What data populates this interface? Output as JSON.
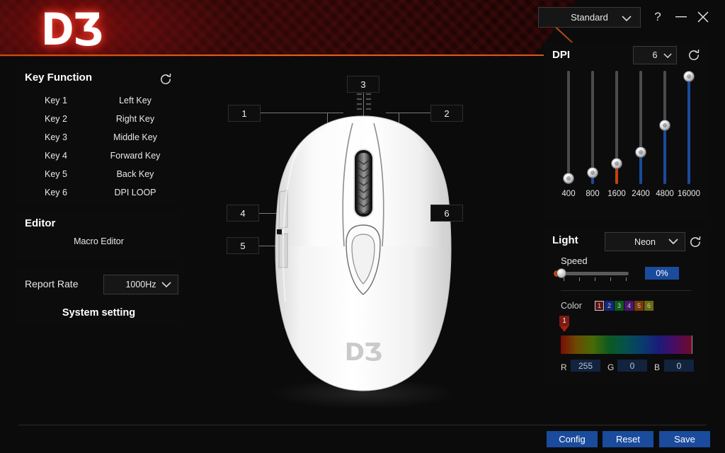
{
  "header": {
    "logo_text": "DƷ",
    "profile": {
      "value": "Standard",
      "caret": "chevron-down-icon"
    },
    "help": "?",
    "minimize": "—",
    "close": "✕"
  },
  "sidebar": {
    "key_function": {
      "title": "Key Function",
      "refresh": "refresh-icon",
      "rows": [
        {
          "key": "Key 1",
          "value": "Left Key"
        },
        {
          "key": "Key 2",
          "value": "Right Key"
        },
        {
          "key": "Key 3",
          "value": "Middle Key"
        },
        {
          "key": "Key 4",
          "value": "Forward Key"
        },
        {
          "key": "Key 5",
          "value": "Back Key"
        },
        {
          "key": "Key 6",
          "value": "DPI LOOP"
        }
      ]
    },
    "editor": {
      "title": "Editor",
      "item": "Macro Editor"
    },
    "report_rate": {
      "label": "Report Rate",
      "value": "1000Hz",
      "caret": "chevron-down-icon"
    },
    "system_setting": "System setting"
  },
  "diagram": {
    "callouts": [
      {
        "id": "1",
        "label": "1"
      },
      {
        "id": "2",
        "label": "2"
      },
      {
        "id": "3",
        "label": "3"
      },
      {
        "id": "4",
        "label": "4"
      },
      {
        "id": "5",
        "label": "5"
      },
      {
        "id": "6",
        "label": "6"
      }
    ],
    "mouse_logo": "DƷ"
  },
  "dpi": {
    "title": "DPI",
    "stage_value": "6",
    "caret": "chevron-down-icon",
    "refresh": "refresh-icon",
    "stages": [
      {
        "label": "400",
        "value": 400,
        "percent": 5,
        "color": "#1a4b9c"
      },
      {
        "label": "800",
        "value": 800,
        "percent": 10,
        "color": "#1a4b9c"
      },
      {
        "label": "1600",
        "value": 1600,
        "percent": 18,
        "color": "#c2440d"
      },
      {
        "label": "2400",
        "value": 2400,
        "percent": 28,
        "color": "#1a4b9c"
      },
      {
        "label": "4800",
        "value": 4800,
        "percent": 52,
        "color": "#1a4b9c"
      },
      {
        "label": "16000",
        "value": 16000,
        "percent": 95,
        "color": "#1a4b9c"
      }
    ]
  },
  "light": {
    "title": "Light",
    "mode": "Neon",
    "caret": "chevron-down-icon",
    "refresh": "refresh-icon",
    "speed": {
      "label": "Speed",
      "value": "0%",
      "percent": 0
    },
    "color_label": "Color",
    "swatches": [
      {
        "label": "1",
        "color": "#5c1414",
        "selected": true
      },
      {
        "label": "2",
        "color": "#13277a",
        "selected": false
      },
      {
        "label": "3",
        "color": "#0e5a1e",
        "selected": false
      },
      {
        "label": "4",
        "color": "#4a1570",
        "selected": false
      },
      {
        "label": "5",
        "color": "#7a3a08",
        "selected": false
      },
      {
        "label": "6",
        "color": "#6a6a10",
        "selected": false
      }
    ],
    "hue_marker": "1",
    "rgb": {
      "r_label": "R",
      "r_value": "255",
      "g_label": "G",
      "g_value": "0",
      "b_label": "B",
      "b_value": "0"
    }
  },
  "footer": {
    "config": "Config",
    "reset": "Reset",
    "save": "Save"
  }
}
